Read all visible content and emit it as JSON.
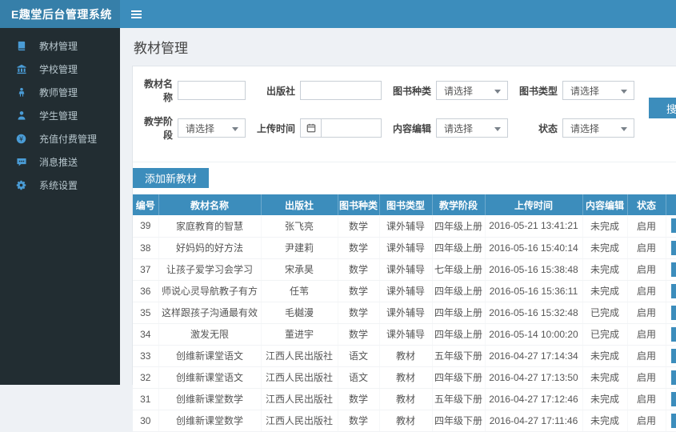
{
  "app": {
    "title": "E趣堂后台管理系统"
  },
  "topbar": {
    "hamburger_icon": "menu-toggle"
  },
  "sidebar": {
    "items": [
      {
        "icon": "book-icon",
        "label": "教材管理"
      },
      {
        "icon": "bank-icon",
        "label": "学校管理"
      },
      {
        "icon": "teacher-icon",
        "label": "教师管理"
      },
      {
        "icon": "student-icon",
        "label": "学生管理"
      },
      {
        "icon": "coin-icon",
        "label": "充值付费管理"
      },
      {
        "icon": "comment-icon",
        "label": "消息推送"
      },
      {
        "icon": "gear-icon",
        "label": "系统设置"
      }
    ]
  },
  "page": {
    "title": "教材管理"
  },
  "search_form": {
    "labels": {
      "name": "教材名称",
      "publisher": "出版社",
      "kind": "图书种类",
      "type": "图书类型",
      "stage": "教学阶段",
      "time": "上传时间",
      "editor": "内容编辑",
      "status": "状态"
    },
    "values": {
      "name": "",
      "publisher": "",
      "time": "",
      "kind": "请选择",
      "type": "请选择",
      "stage": "请选择",
      "editor": "请选择",
      "status": "请选择"
    },
    "search_button": "搜索"
  },
  "toolbar": {
    "add_button": "添加新教材"
  },
  "table": {
    "headers": [
      "编号",
      "教材名称",
      "出版社",
      "图书种类",
      "图书类型",
      "教学阶段",
      "上传时间",
      "内容编辑",
      "状态",
      ""
    ],
    "rows": [
      [
        "39",
        "家庭教育的智慧",
        "张飞亮",
        "数学",
        "课外辅导",
        "四年级上册",
        "2016-05-21 13:41:21",
        "未完成",
        "启用"
      ],
      [
        "38",
        "好妈妈的好方法",
        "尹建莉",
        "数学",
        "课外辅导",
        "四年级上册",
        "2016-05-16 15:40:14",
        "未完成",
        "启用"
      ],
      [
        "37",
        "让孩子爱学习会学习",
        "宋承昊",
        "数学",
        "课外辅导",
        "七年级上册",
        "2016-05-16 15:38:48",
        "未完成",
        "启用"
      ],
      [
        "36",
        "师说心灵导航教子有方",
        "任苇",
        "数学",
        "课外辅导",
        "四年级上册",
        "2016-05-16 15:36:11",
        "未完成",
        "启用"
      ],
      [
        "35",
        "这样跟孩子沟通最有效",
        "毛樾漫",
        "数学",
        "课外辅导",
        "四年级上册",
        "2016-05-16 15:32:48",
        "已完成",
        "启用"
      ],
      [
        "34",
        "激发无限",
        "董进宇",
        "数学",
        "课外辅导",
        "四年级上册",
        "2016-05-14 10:00:20",
        "已完成",
        "启用"
      ],
      [
        "33",
        "创维新课堂语文",
        "江西人民出版社",
        "语文",
        "教材",
        "五年级下册",
        "2016-04-27 17:14:34",
        "未完成",
        "启用"
      ],
      [
        "32",
        "创维新课堂语文",
        "江西人民出版社",
        "语文",
        "教材",
        "四年级下册",
        "2016-04-27 17:13:50",
        "未完成",
        "启用"
      ],
      [
        "31",
        "创维新课堂数学",
        "江西人民出版社",
        "数学",
        "教材",
        "五年级下册",
        "2016-04-27 17:12:46",
        "未完成",
        "启用"
      ],
      [
        "30",
        "创维新课堂数学",
        "江西人民出版社",
        "数学",
        "教材",
        "四年级下册",
        "2016-04-27 17:11:46",
        "未完成",
        "启用"
      ]
    ]
  }
}
